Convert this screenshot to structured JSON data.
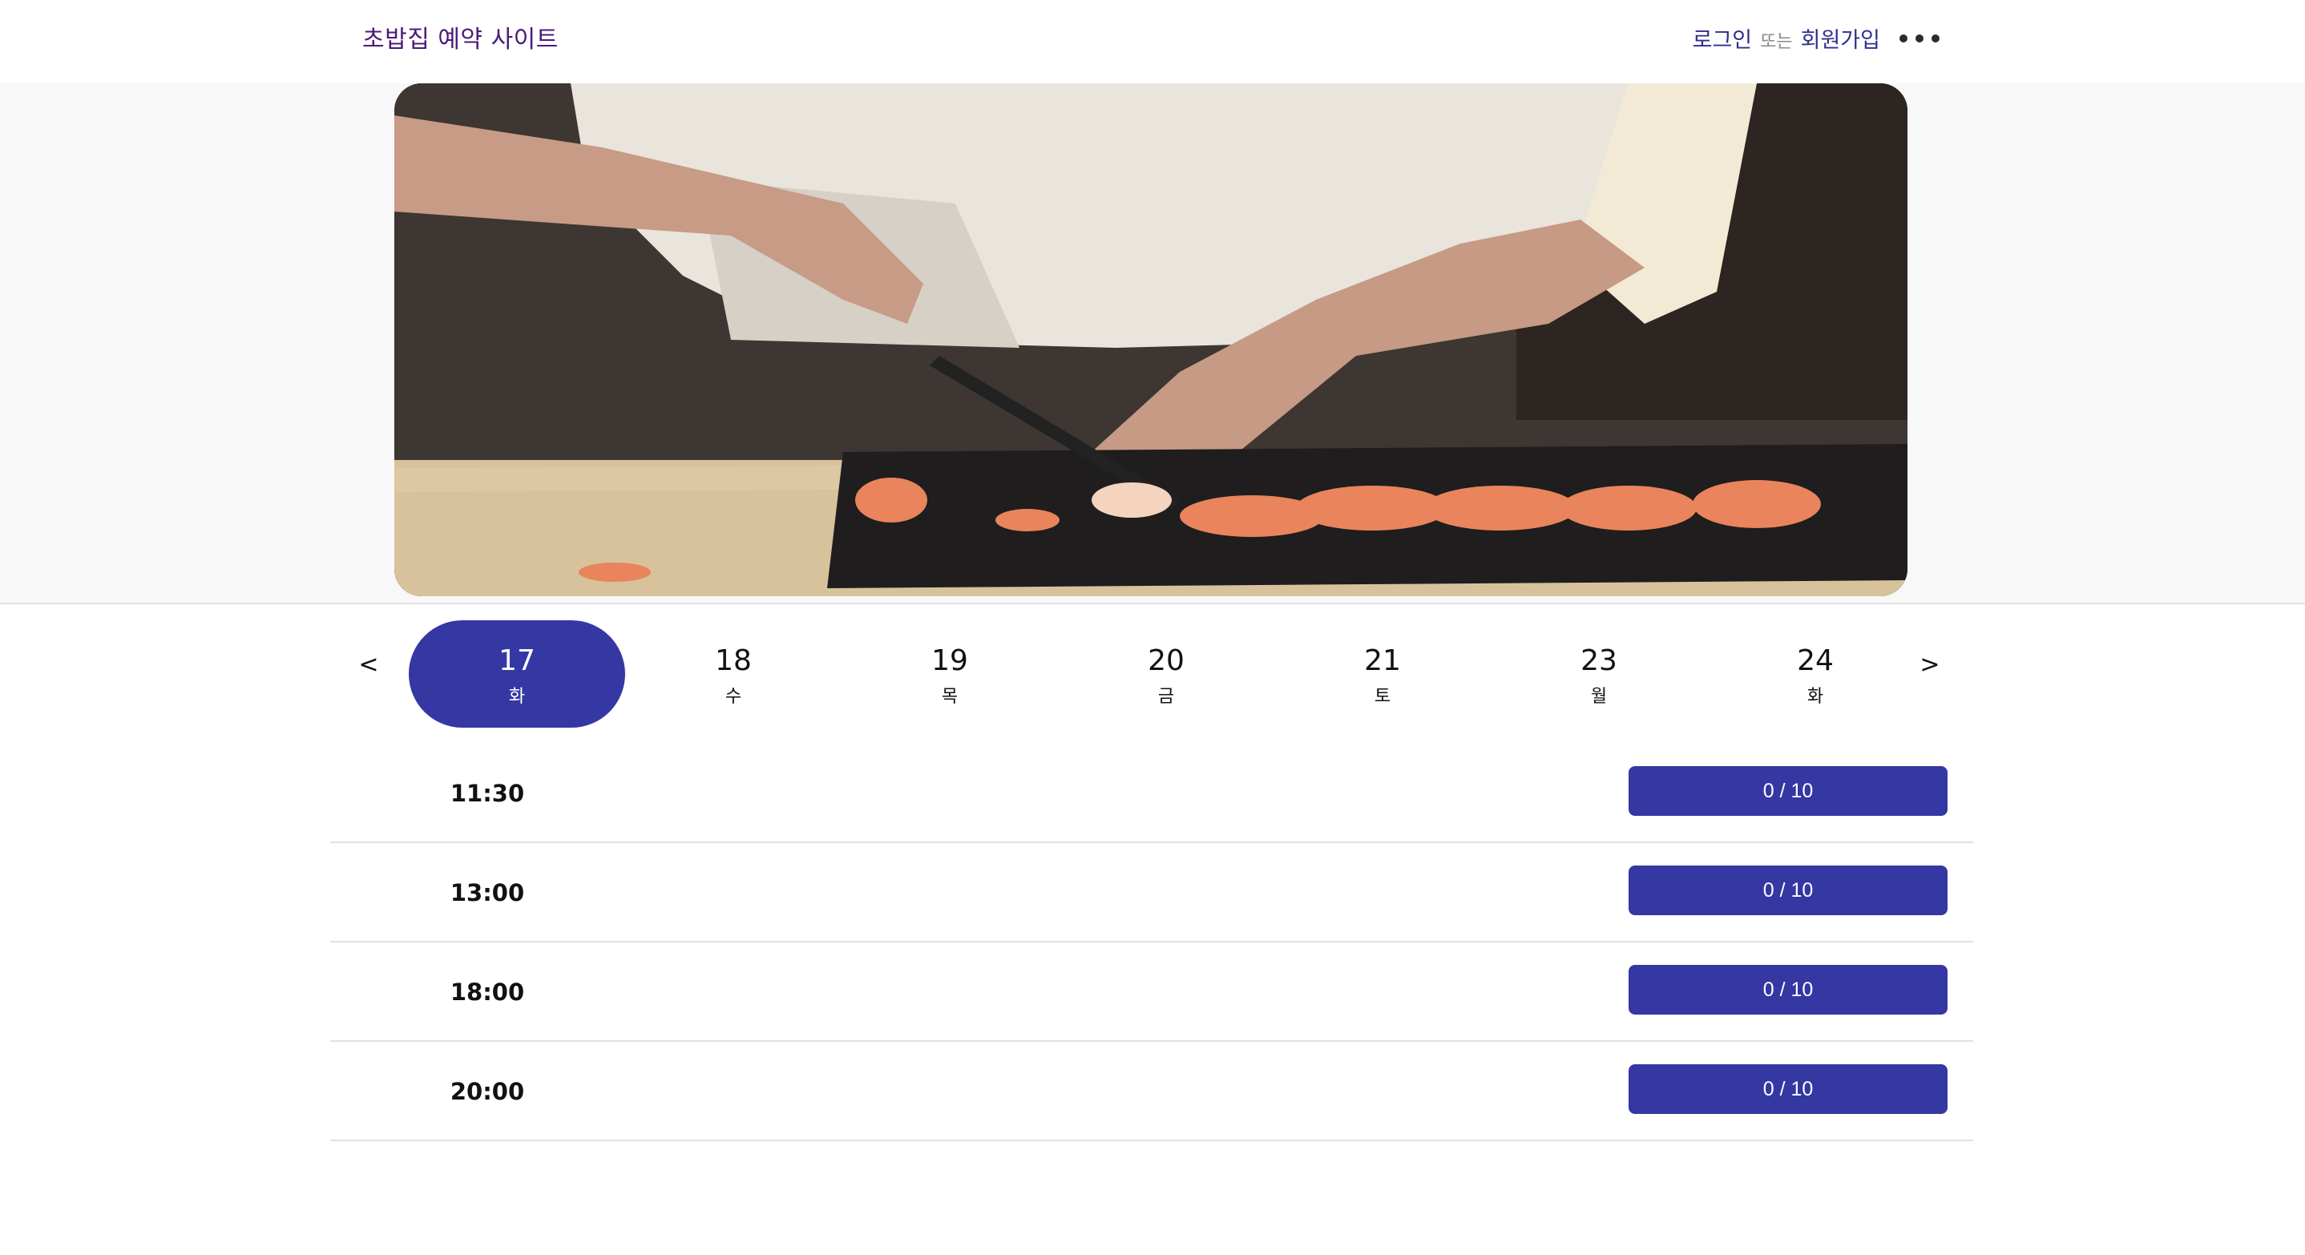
{
  "header": {
    "title": "초밥집 예약 사이트",
    "login_label": "로그인",
    "or_label": "또는",
    "signup_label": "회원가입",
    "more_icon": "more-horizontal-icon"
  },
  "hero": {
    "image_description_icon": "sushi-chef-hero-image"
  },
  "date_nav": {
    "prev_label": "<",
    "next_label": ">",
    "days": [
      {
        "num": "17",
        "dow": "화",
        "selected": true
      },
      {
        "num": "18",
        "dow": "수",
        "selected": false
      },
      {
        "num": "19",
        "dow": "목",
        "selected": false
      },
      {
        "num": "20",
        "dow": "금",
        "selected": false
      },
      {
        "num": "21",
        "dow": "토",
        "selected": false
      },
      {
        "num": "23",
        "dow": "월",
        "selected": false
      },
      {
        "num": "24",
        "dow": "화",
        "selected": false
      }
    ]
  },
  "slots": [
    {
      "time": "11:30",
      "capacity": "0 / 10"
    },
    {
      "time": "13:00",
      "capacity": "0 / 10"
    },
    {
      "time": "18:00",
      "capacity": "0 / 10"
    },
    {
      "time": "20:00",
      "capacity": "0 / 10"
    }
  ],
  "colors": {
    "accent": "#3537a3",
    "title": "#4b1b7a",
    "link": "#2f2f8f"
  }
}
